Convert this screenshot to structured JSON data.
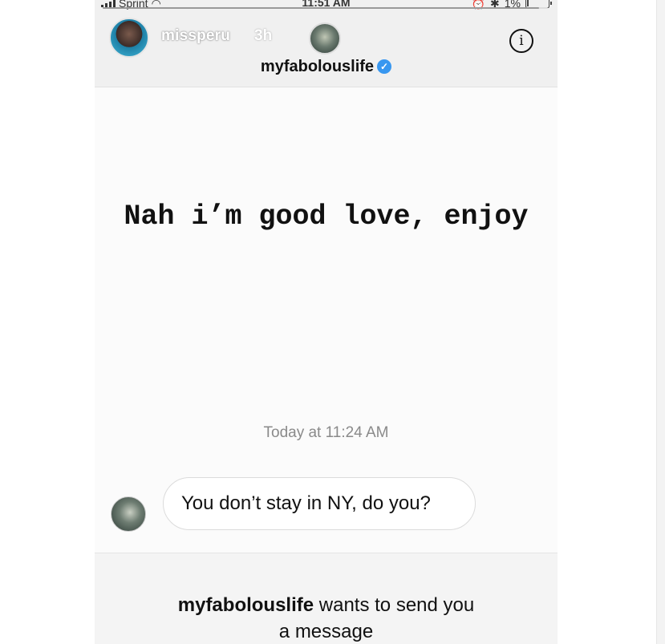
{
  "status_bar": {
    "carrier": "Sprint",
    "time": "11:51 AM",
    "battery": "1%",
    "battery_level": 0.01
  },
  "story": {
    "username": "missperu",
    "time_ago": "3h",
    "progress": 0.98,
    "info_icon": "i"
  },
  "thread": {
    "sender": "myfabolouslife",
    "caption": "Nah i’m good love, enjoy",
    "timestamp": "Today at 11:24 AM",
    "message": "You don’t stay in NY, do you?"
  },
  "request": {
    "sender": "myfabolouslife",
    "text_line1": " wants to send you",
    "text_line2": "a message"
  },
  "icons": [
    "signal-icon",
    "wifi-icon",
    "alarm-icon",
    "bluetooth-icon",
    "battery-icon",
    "info-icon",
    "verified-badge-icon"
  ],
  "colors": {
    "verified": "#3897f0",
    "timestamp": "#8a8a8a"
  }
}
